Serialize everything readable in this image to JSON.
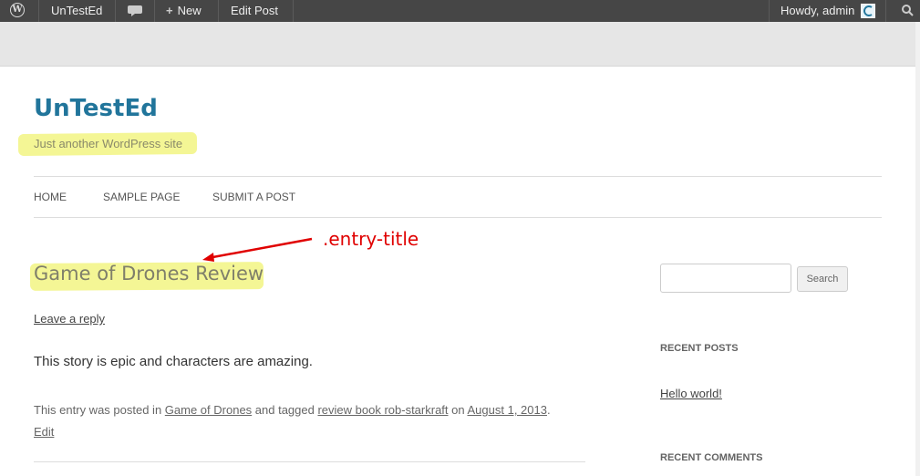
{
  "adminbar": {
    "logo_icon": "wordpress-logo-icon",
    "site_name": "UnTestEd",
    "comments_icon": "comment-bubble-icon",
    "new_label": "New",
    "new_icon": "plus-icon",
    "edit_post": "Edit Post",
    "howdy": "Howdy, admin",
    "avatar_icon": "avatar-icon",
    "search_icon": "search-icon"
  },
  "header": {
    "site_title": "UnTestEd",
    "site_description": "Just another WordPress site"
  },
  "nav": {
    "items": [
      "HOME",
      "SAMPLE PAGE",
      "SUBMIT A POST"
    ]
  },
  "annotation": {
    "label": ".entry-title",
    "color": "#e00000",
    "highlight_color": "#f3f58a"
  },
  "entry": {
    "title": "Game of Drones Review",
    "leave_reply": "Leave a reply",
    "content": "This story is epic and characters are amazing.",
    "meta_prefix": "This entry was posted in ",
    "category": "Game of Drones",
    "meta_tagged": " and tagged ",
    "tags": "review book rob-starkraft",
    "meta_on": " on ",
    "date": "August 1, 2013",
    "meta_end": ".",
    "edit": "Edit"
  },
  "sidebar": {
    "search_placeholder": "",
    "search_button": "Search",
    "recent_posts_title": "RECENT POSTS",
    "recent_posts": [
      "Hello world!"
    ],
    "recent_comments_title": "RECENT COMMENTS"
  },
  "colors": {
    "adminbar_bg": "#464646",
    "site_title": "#21759b"
  }
}
